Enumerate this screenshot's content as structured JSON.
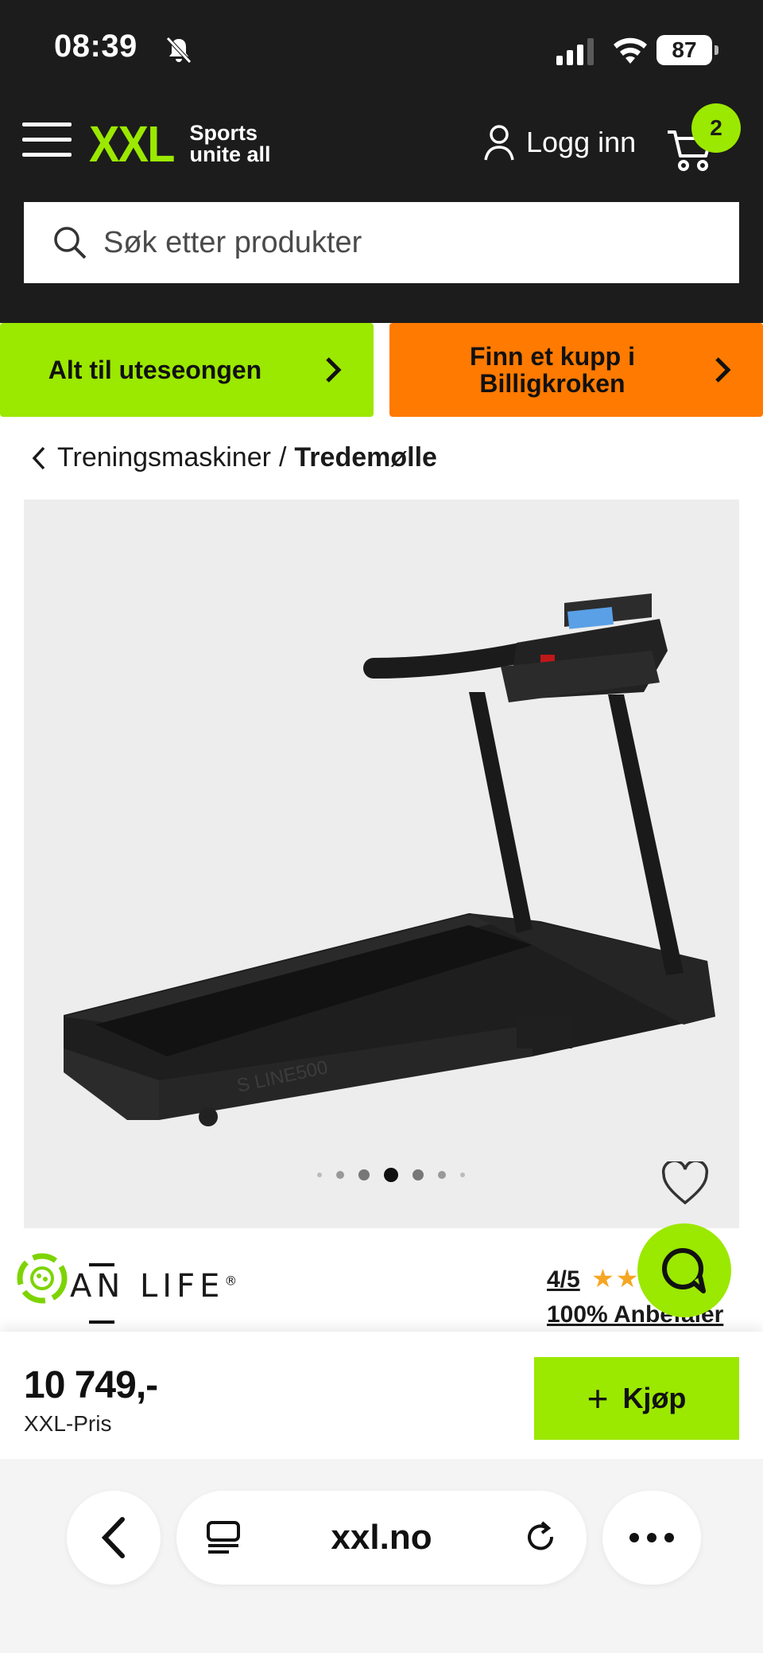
{
  "status_bar": {
    "time": "08:39",
    "battery": "87"
  },
  "header": {
    "logo_text": "XXL",
    "logo_tagline_1": "Sports",
    "logo_tagline_2": "unite all",
    "login_label": "Logg inn",
    "cart_count": "2",
    "accent_color": "#9be800"
  },
  "search": {
    "placeholder": "Søk etter produkter"
  },
  "promos": [
    {
      "label": "Alt til uteseongen",
      "color": "#9be800"
    },
    {
      "label_line1": "Finn et kupp i",
      "label_line2": "Billigkroken",
      "color": "#ff7a00"
    }
  ],
  "breadcrumb": {
    "parent": "Treningsmaskiner",
    "separator": "/",
    "current": "Tredemølle"
  },
  "gallery": {
    "dots_total": 7,
    "active_dot": 4
  },
  "product": {
    "brand": "AN LIFE",
    "brand_mark": "®",
    "rating": "4/5",
    "stars": "★★★★★",
    "recommend": "100% Anbefaler",
    "price": "10 749,-",
    "price_label": "XXL-Pris",
    "buy_label": "Kjøp",
    "deck_label": "S LINE500"
  },
  "browser": {
    "url": "xxl.no"
  }
}
